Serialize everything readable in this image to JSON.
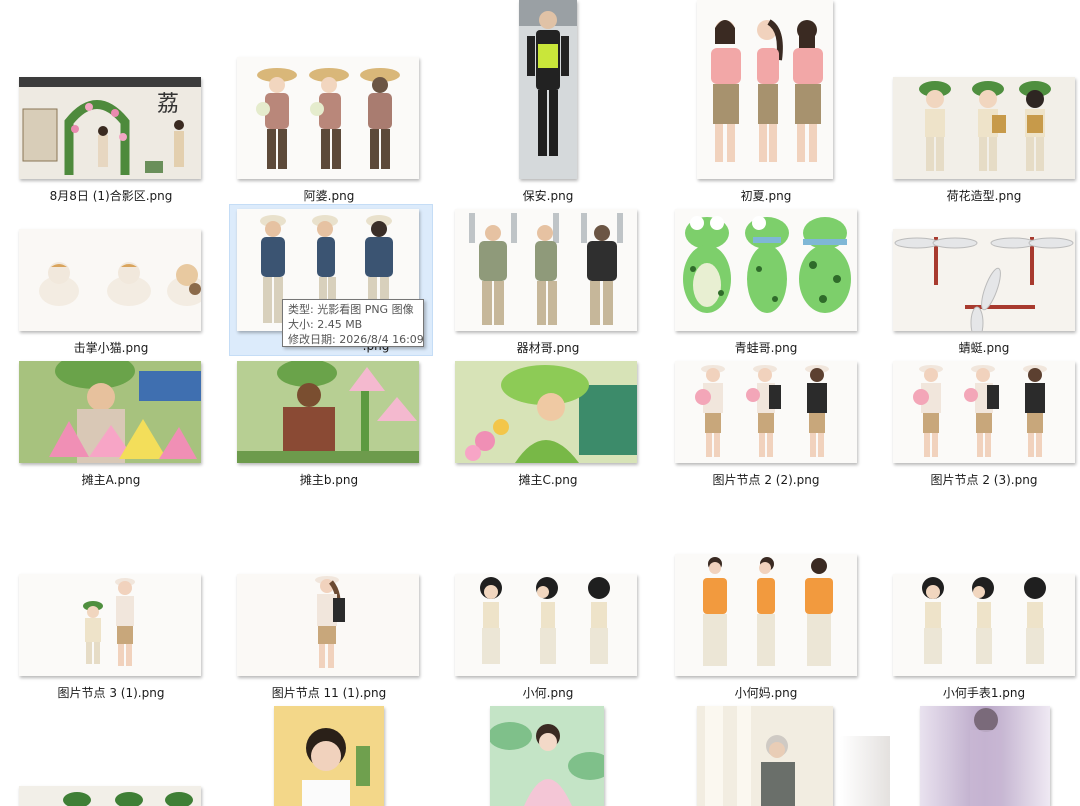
{
  "files": [
    {
      "name": "8月8日 (1)合影区.png",
      "label": "8月8日 (1)合影区.png"
    },
    {
      "name": "阿婆.png",
      "label": "阿婆.png"
    },
    {
      "name": "保安.png",
      "label": "保安.png"
    },
    {
      "name": "初夏.png",
      "label": "初夏.png"
    },
    {
      "name": "荷花造型.png",
      "label": "荷花造型.png"
    },
    {
      "name": "击掌小猫.png",
      "label": "击掌小猫.png"
    },
    {
      "name": "摄影师.png",
      "label": ".png"
    },
    {
      "name": "器材哥.png",
      "label": "器材哥.png"
    },
    {
      "name": "青蛙哥.png",
      "label": "青蛙哥.png"
    },
    {
      "name": "蜻蜓.png",
      "label": "蜻蜓.png"
    },
    {
      "name": "摊主A.png",
      "label": "摊主A.png"
    },
    {
      "name": "摊主b.png",
      "label": "摊主b.png"
    },
    {
      "name": "摊主C.png",
      "label": "摊主C.png"
    },
    {
      "name": "图片节点 2 (2).png",
      "label": "图片节点 2 (2).png"
    },
    {
      "name": "图片节点 2 (3).png",
      "label": "图片节点 2 (3).png"
    },
    {
      "name": "图片节点 3 (1).png",
      "label": "图片节点 3 (1).png"
    },
    {
      "name": "图片节点 11 (1).png",
      "label": "图片节点 11 (1).png"
    },
    {
      "name": "小何.png",
      "label": "小何.png"
    },
    {
      "name": "小何妈.png",
      "label": "小何妈.png"
    },
    {
      "name": "小何手表1.png",
      "label": "小何手表1.png"
    }
  ],
  "tooltip": {
    "type": "类型: 光影看图 PNG 图像",
    "size": "大小: 2.45 MB",
    "modified": "修改日期: 2026/8/4 16:09"
  },
  "thumb_text": {
    "poster_char": "荔"
  }
}
